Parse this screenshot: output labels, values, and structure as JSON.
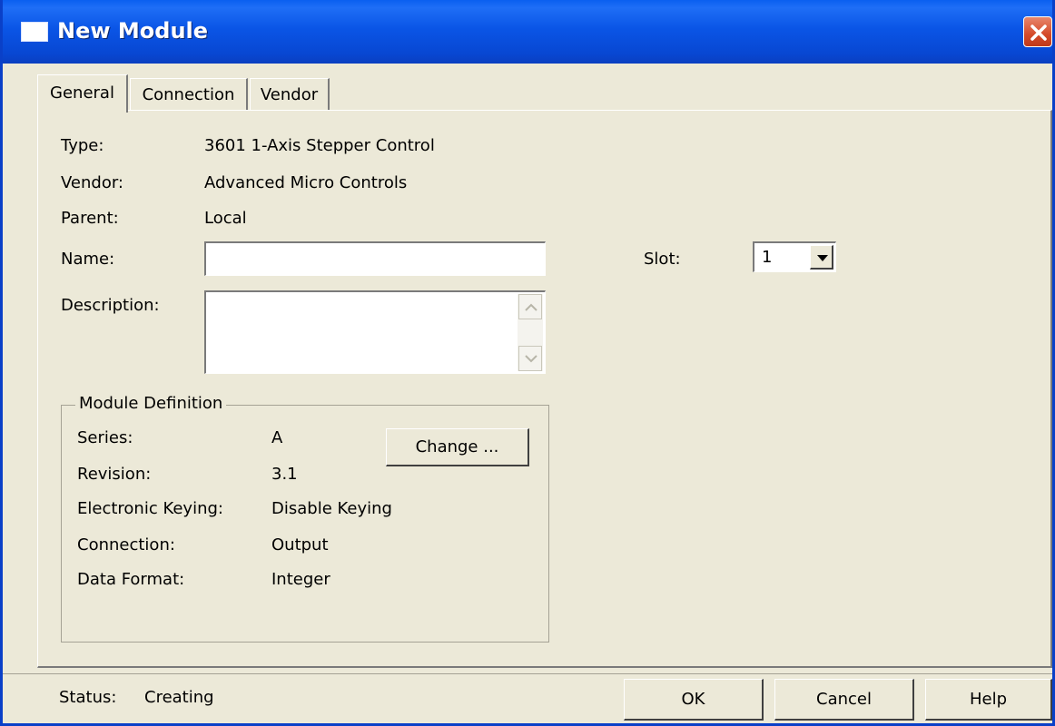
{
  "window": {
    "title": "New Module",
    "close_icon": "close-icon"
  },
  "tabs": [
    {
      "label": "General",
      "active": true
    },
    {
      "label": "Connection",
      "active": false
    },
    {
      "label": "Vendor",
      "active": false
    }
  ],
  "general": {
    "type_label": "Type:",
    "type_value": "3601 1-Axis Stepper Control",
    "vendor_label": "Vendor:",
    "vendor_value": "Advanced Micro Controls",
    "parent_label": "Parent:",
    "parent_value": "Local",
    "name_label": "Name:",
    "name_value": "",
    "description_label": "Description:",
    "description_value": "",
    "slot_label": "Slot:",
    "slot_value": "1"
  },
  "module_definition": {
    "title": "Module Definition",
    "series_label": "Series:",
    "series_value": "A",
    "revision_label": "Revision:",
    "revision_value": "3.1",
    "keying_label": "Electronic Keying:",
    "keying_value": "Disable Keying",
    "connection_label": "Connection:",
    "connection_value": "Output",
    "data_format_label": "Data Format:",
    "data_format_value": "Integer",
    "change_button": "Change ..."
  },
  "status": {
    "label": "Status:",
    "value": "Creating"
  },
  "buttons": {
    "ok": "OK",
    "cancel": "Cancel",
    "help": "Help"
  },
  "colors": {
    "titlebar": "#0a55e6",
    "dialog_bg": "#ece9d8",
    "close_button": "#d44a2a"
  }
}
